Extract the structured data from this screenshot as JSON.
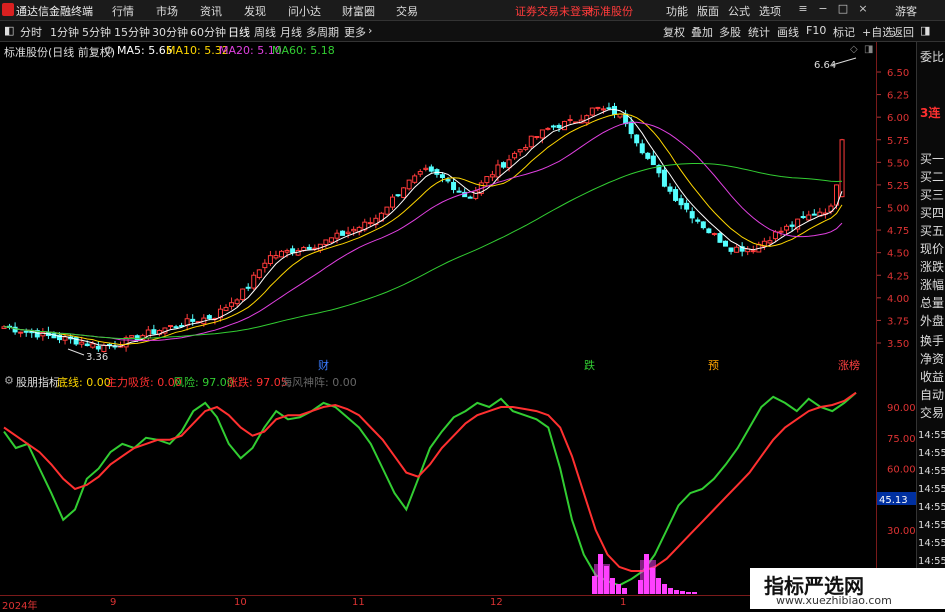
{
  "titlebar": {
    "app_name": "通达信金融终端",
    "menu": [
      "行情",
      "市场",
      "资讯",
      "发现",
      "问小达",
      "财富圈",
      "交易"
    ],
    "status_red": "证券交易未登录",
    "status_red2": "标准股份",
    "right_menu": [
      "功能",
      "版面",
      "公式",
      "选项"
    ],
    "guest": "游客"
  },
  "toolbar": {
    "periods": [
      "分时",
      "1分钟",
      "5分钟",
      "15分钟",
      "30分钟",
      "60分钟",
      "日线",
      "周线",
      "月线",
      "多周期",
      "更多"
    ],
    "active_period": "日线",
    "right_items": [
      "复权",
      "叠加",
      "多股",
      "统计",
      "画线",
      "F10",
      "标记",
      "+自选",
      "返回"
    ]
  },
  "price_panel": {
    "stock_title": "标准股份(日线 前复权)",
    "ma": [
      {
        "label": "MA5: 5.65",
        "color": "#ffffff"
      },
      {
        "label": "MA10: 5.32",
        "color": "#ffd700"
      },
      {
        "label": "MA20: 5.10",
        "color": "#e040e0"
      },
      {
        "label": "MA60: 5.18",
        "color": "#32cd32"
      }
    ],
    "high_label": "6.64",
    "low_label": "3.36",
    "axis_ticks": [
      "6.50",
      "6.25",
      "6.00",
      "5.75",
      "5.50",
      "5.25",
      "5.00",
      "4.75",
      "4.50",
      "4.25",
      "4.00",
      "3.75",
      "3.50"
    ],
    "markers": [
      {
        "text": "财",
        "color": "#3a7cff"
      },
      {
        "text": "跌",
        "color": "#32cd32"
      },
      {
        "text": "预",
        "color": "#ffa500"
      },
      {
        "text": "涨榜",
        "color": "#ff4040"
      }
    ]
  },
  "indicator_panel": {
    "name": "股朋指标",
    "items": [
      {
        "label": "底线: 0.00",
        "color": "#ffd700"
      },
      {
        "label": "主力吸货: 0.00",
        "color": "#ff3030"
      },
      {
        "label": "风险: 97.00",
        "color": "#32cd32"
      },
      {
        "label": "涨跌: 97.05",
        "color": "#ff3030"
      },
      {
        "label": "海风神阵: 0.00",
        "color": "#666666"
      }
    ],
    "axis_ticks": [
      "90.00",
      "75.00",
      "60.00",
      "45.13",
      "30.00"
    ],
    "current_value": "45.13"
  },
  "dates": [
    "2024年",
    "9",
    "10",
    "11",
    "12",
    "1"
  ],
  "sidebar": [
    "委比",
    "3连",
    "买一",
    "买二",
    "买三",
    "买四",
    "买五",
    "现价",
    "涨跌",
    "涨幅",
    "总量",
    "外盘",
    "换手",
    "净资",
    "收益",
    "自动",
    "交易"
  ],
  "time_labels": [
    "14:55",
    "14:55",
    "14:55",
    "14:55",
    "14:55",
    "14:55",
    "14:55",
    "14:55",
    "14:55",
    "14:55"
  ],
  "watermark": {
    "title": "指标严选网",
    "url": "www.xuezhibiao.com"
  }
}
